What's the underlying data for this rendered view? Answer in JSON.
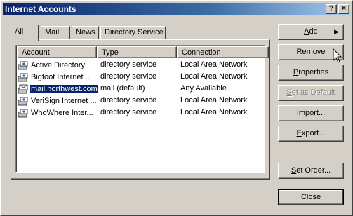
{
  "window": {
    "title": "Internet Accounts",
    "help_label": "?",
    "close_label": "×"
  },
  "tabs": [
    {
      "label": "All",
      "active": true
    },
    {
      "label": "Mail",
      "active": false
    },
    {
      "label": "News",
      "active": false
    },
    {
      "label": "Directory Service",
      "active": false
    }
  ],
  "list": {
    "columns": [
      "Account",
      "Type",
      "Connection"
    ],
    "rows": [
      {
        "account": "Active Directory",
        "type": "directory service",
        "connection": "Local Area Network",
        "selected": false
      },
      {
        "account": "Bigfoot Internet ...",
        "type": "directory service",
        "connection": "Local Area Network",
        "selected": false
      },
      {
        "account": "mail.northwest.com",
        "type": "mail (default)",
        "connection": "Any Available",
        "selected": true
      },
      {
        "account": "VeriSign Internet ...",
        "type": "directory service",
        "connection": "Local Area Network",
        "selected": false
      },
      {
        "account": "WhoWhere Inter...",
        "type": "directory service",
        "connection": "Local Area Network",
        "selected": false
      }
    ]
  },
  "buttons": {
    "add": {
      "pre": "",
      "key": "A",
      "post": "dd"
    },
    "remove": {
      "pre": "",
      "key": "R",
      "post": "emove"
    },
    "properties": {
      "pre": "",
      "key": "P",
      "post": "roperties"
    },
    "set_default": {
      "pre": "",
      "key": "S",
      "post": "et as Default"
    },
    "import": {
      "pre": "",
      "key": "I",
      "post": "mport..."
    },
    "export": {
      "pre": "",
      "key": "E",
      "post": "xport..."
    },
    "set_order": {
      "pre": "",
      "key": "S",
      "post": "et Order..."
    },
    "close": "Close"
  }
}
